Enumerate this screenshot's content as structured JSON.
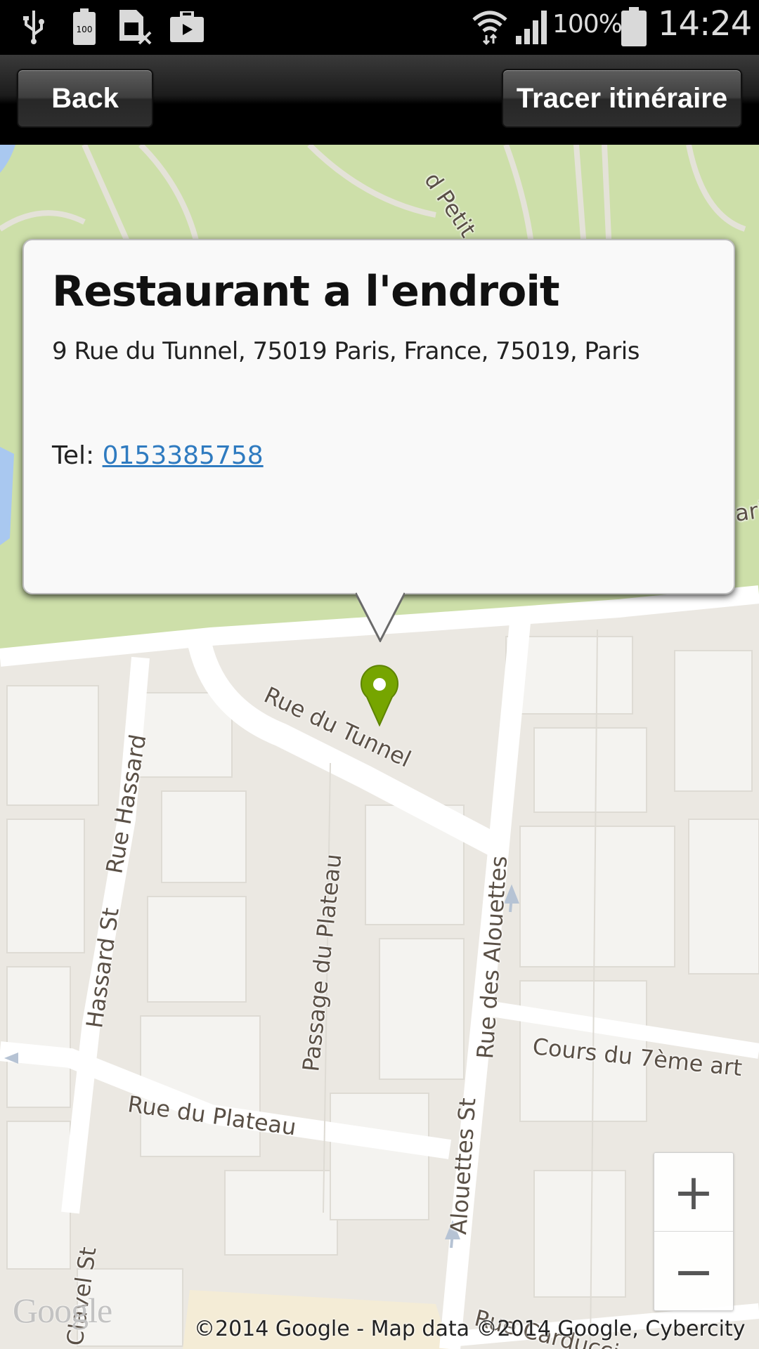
{
  "status_bar": {
    "icons_left": [
      "usb-icon",
      "battery-100-icon",
      "no-sim-icon",
      "briefcase-icon"
    ],
    "battery_percent": "100%",
    "time": "14:24",
    "icons_right": [
      "wifi-icon",
      "signal-icon",
      "battery-icon"
    ]
  },
  "toolbar": {
    "back_label": "Back",
    "route_label": "Tracer itinéraire"
  },
  "info_window": {
    "title": "Restaurant a l'endroit",
    "address": "9 Rue du Tunnel, 75019 Paris, France, 75019, Paris",
    "tel_label": "Tel: ",
    "tel_number": "0153385758"
  },
  "map": {
    "street_labels": {
      "petit": "d Petit",
      "rue_du_tunnel": "Rue du Tunnel",
      "rue_hassard": "Rue Hassard",
      "hassard_st": "Hassard St",
      "passage_du_plateau": "Passage du Plateau",
      "rue_des_alouettes": "Rue des Alouettes",
      "alouettes_st": "Alouettes St",
      "cours_7eme_art": "Cours du 7ème art",
      "rue_du_plateau": "Rue du Plateau",
      "clavel_st": "Clavel St",
      "rue_carducci": "Rue Carducci",
      "ari": "ari"
    },
    "marker_color": "#76a500",
    "zoom_in_label": "+",
    "zoom_out_label": "−",
    "logo": "Google",
    "attribution": "©2014 Google - Map data ©2014 Google, Cybercity"
  },
  "colors": {
    "link": "#2f7bc0",
    "park": "#cddfa9",
    "land": "#ebe8e2",
    "road": "#ffffff"
  }
}
